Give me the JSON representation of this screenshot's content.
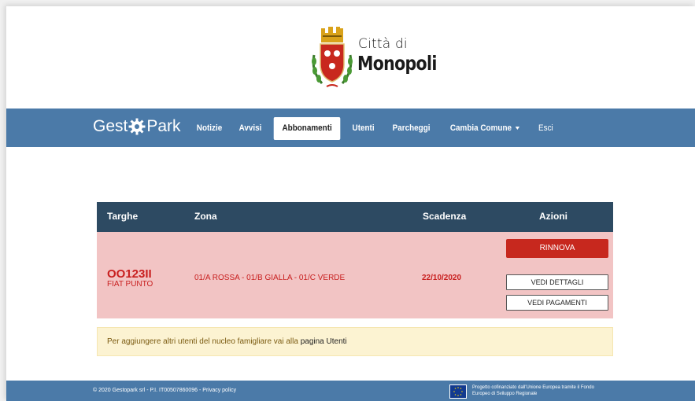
{
  "header": {
    "city_prefix": "Città di",
    "city_name": "Monopoli"
  },
  "navbar": {
    "brand_left": "Gest",
    "brand_right": "Park",
    "items": [
      {
        "label": "Notizie"
      },
      {
        "label": "Avvisi"
      },
      {
        "label": "Abbonamenti",
        "active": true
      },
      {
        "label": "Utenti"
      },
      {
        "label": "Parcheggi"
      },
      {
        "label": "Cambia Comune"
      },
      {
        "label": "Esci"
      }
    ]
  },
  "table": {
    "headers": [
      "Targhe",
      "Zona",
      "Scadenza",
      "Azioni"
    ],
    "rows": [
      {
        "plate": "OO123II",
        "car": "FIAT PUNTO",
        "zone": "01/A ROSSA - 01/B GIALLA - 01/C VERDE",
        "expiry": "22/10/2020",
        "actions": [
          "RINNOVA",
          "VEDI DETTAGLI",
          "VEDI PAGAMENTI"
        ]
      }
    ]
  },
  "notice": {
    "text": "Per aggiungere altri utenti del nucleo famigliare vai alla ",
    "link": "pagina Utenti"
  },
  "footer": {
    "left": "© 2020 Gestopark srl - P.I. IT00507860096 - Privacy policy",
    "right_line1": "Progetto cofinanziato dall'Unione Europea tramite il Fondo",
    "right_line2": "Europeo di Sviluppo Regionale"
  },
  "colors": {
    "navbar": "#4b7aa8",
    "table_header": "#2d4a62",
    "row_bg": "#f2c4c4",
    "danger": "#c7281e",
    "notice_bg": "#fcf3d2"
  }
}
